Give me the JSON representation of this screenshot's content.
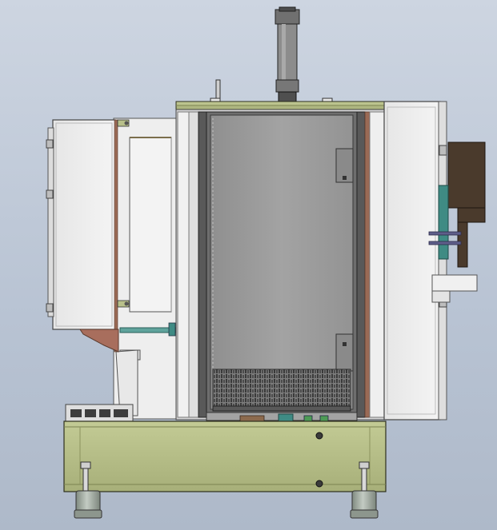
{
  "drawing": {
    "view": "side elevation",
    "colors": {
      "background_top": "#cdd5e1",
      "background_bottom": "#aeb9c9",
      "frame_olive": "#b8c08a",
      "frame_olive_dark": "#6f7548",
      "panel_white": "#ededed",
      "panel_grey": "#dcdcdc",
      "chamber_grey": "#9c9c9c",
      "chamber_dark": "#5d5d5d",
      "copper_trim": "#9a6a55",
      "dark_brown": "#4a3a2c",
      "teal_accent": "#3f8b84",
      "foot_grey": "#9aa39a"
    },
    "parts": [
      "top-cylinder",
      "top-plate",
      "left-cabinet",
      "door-frame",
      "chamber-window",
      "heating-elements",
      "right-panel",
      "right-bracket",
      "base-frame",
      "leveling-feet"
    ]
  }
}
